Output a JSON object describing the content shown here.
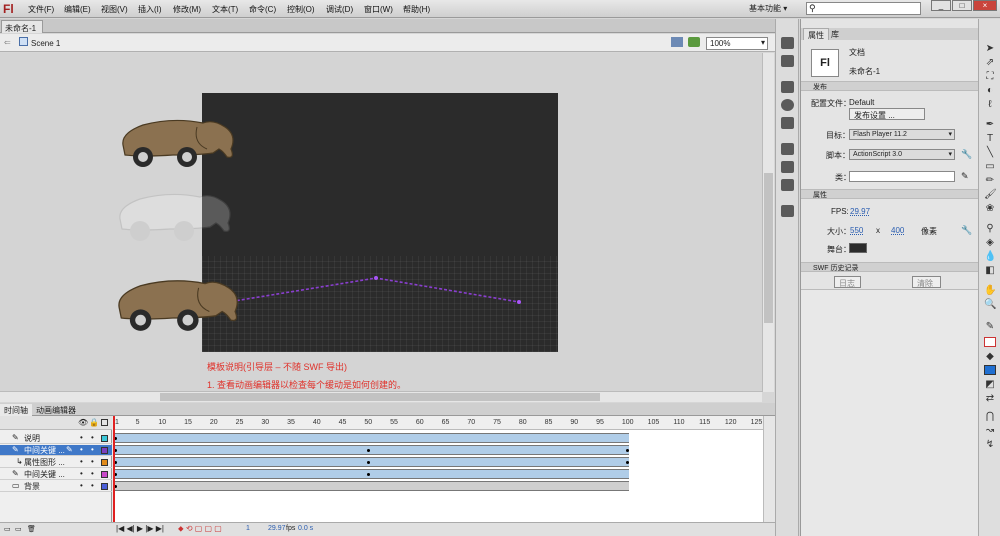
{
  "app": {
    "logo": "Fl"
  },
  "menu": [
    "文件(F)",
    "编辑(E)",
    "视图(V)",
    "插入(I)",
    "修改(M)",
    "文本(T)",
    "命令(C)",
    "控制(O)",
    "调试(D)",
    "窗口(W)",
    "帮助(H)"
  ],
  "workspace": "基本功能",
  "search": {
    "value": "",
    "placeholder": ""
  },
  "doc_tab": "未命名-1",
  "edit_bar": {
    "scene": "Scene 1",
    "zoom": "100%"
  },
  "stage": {
    "annotation_title": "模板说明(引导层 – 不随 SWF 导出)",
    "annotation_line": "1. 查看动画编辑器以检查每个缓动是如何创建的。",
    "stage_color": "#2b2b2b",
    "guide_color": "#8a3fd0"
  },
  "timeline": {
    "tabs": [
      "时间轴",
      "动画编辑器"
    ],
    "ruler": [
      "1",
      "5",
      "10",
      "15",
      "20",
      "25",
      "30",
      "35",
      "40",
      "45",
      "50",
      "55",
      "60",
      "65",
      "70",
      "75",
      "80",
      "85",
      "90",
      "95",
      "100",
      "105",
      "110",
      "115",
      "120",
      "125"
    ],
    "layers": [
      {
        "name": "说明",
        "color": "#3cc8d8"
      },
      {
        "name": "中间关键 ...",
        "color": "#7a3fbf"
      },
      {
        "name": "属性图形 ...",
        "color": "#e08a1a"
      },
      {
        "name": "中间关键 ...",
        "color": "#c848c8"
      },
      {
        "name": "背景",
        "color": "#4a5fd8"
      }
    ],
    "status": {
      "frame": "1",
      "fps": "29.97",
      "fps_unit": "fps",
      "time": "0.0 s"
    }
  },
  "properties": {
    "tabs": [
      "属性",
      "库"
    ],
    "doc_icon": "Fl",
    "doc_type": "文档",
    "doc_name": "未命名-1",
    "publish_section": "发布",
    "profile_label": "配置文件：",
    "profile_value": "Default",
    "publish_settings_btn": "发布设置 ...",
    "target_label": "目标：",
    "target_value": "Flash Player 11.2",
    "script_label": "脚本：",
    "script_value": "ActionScript 3.0",
    "class_label": "类：",
    "class_value": "",
    "props_section": "属性",
    "fps_label": "FPS:",
    "fps_value": "29.97",
    "size_label": "大小：",
    "width": "550",
    "x": "x",
    "height": "400",
    "unit": "像素",
    "stage_label": "舞台：",
    "history_section": "SWF 历史记录",
    "log_btn": "日志",
    "clear_btn": "清除"
  },
  "window_buttons": [
    "_",
    "□",
    "×"
  ]
}
